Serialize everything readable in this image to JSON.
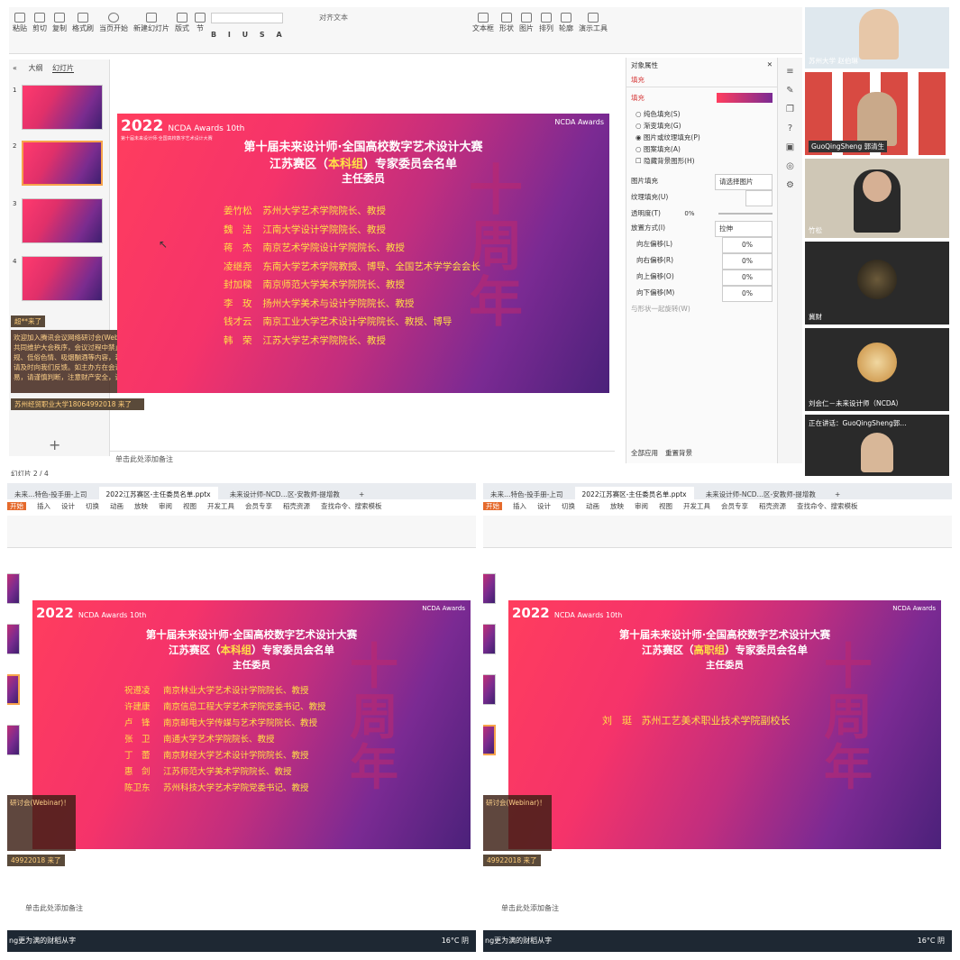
{
  "top": {
    "ribbon": {
      "row1": [
        "粘贴",
        "剪切",
        "复制",
        "格式刷",
        "当页开始",
        "新建幻灯片",
        "版式",
        "节",
        "文本框",
        "形状",
        "图片",
        "演示工具"
      ],
      "row2": [
        "对齐文本",
        "排列",
        "轮廓"
      ]
    },
    "outline_tabs": [
      "大纲",
      "幻灯片"
    ],
    "thumb_numbers": [
      "1",
      "2",
      "3",
      "4"
    ],
    "notes_placeholder": "单击此处添加备注",
    "status": "幻灯片 2 / 4",
    "properties": {
      "title": "对象属性",
      "tab": "填充",
      "section": "填充",
      "options": [
        "纯色填充(S)",
        "渐变填充(G)",
        "图片或纹理填充(P)",
        "图案填充(A)",
        "隐藏背景图形(H)"
      ],
      "picture_fill_label": "图片填充",
      "picture_fill_value": "请选择图片",
      "texture_label": "纹理填充(U)",
      "transparency_label": "透明度(T)",
      "transparency_value": "0%",
      "placement_label": "放置方式(I)",
      "placement_value": "拉伸",
      "offsets": [
        {
          "label": "向左偏移(L)",
          "value": "0%"
        },
        {
          "label": "向右偏移(R)",
          "value": "0%"
        },
        {
          "label": "向上偏移(O)",
          "value": "0%"
        },
        {
          "label": "向下偏移(M)",
          "value": "0%"
        }
      ],
      "rotate_label": "与形状一起旋转(W)",
      "apply_all": "全部应用",
      "reset": "重置背景"
    },
    "chat_note": "超**来了",
    "chat_text": "欢迎加入腾讯会议网络研讨会(Webinar)！请大家共同维护大会秩序，会议过程中禁止出现违法违规、低俗色情、吸烟酗酒等内容，若发现违规行为请及时向我们反馈。如主办方在会议过程中引导交易，请谨慎判断，注意财产安全，谨防诈骗！",
    "chat_join": "苏州经贸职业大学18064992018 来了"
  },
  "slides": {
    "logo_year": "2022",
    "logo_brand": "NCDA Awards 10th",
    "logo_sub": "第十届未来设计师·全国高校数字艺术设计大赛",
    "corner_logo": "NCDA Awards",
    "title1": "第十届未来设计师·全国高校数字艺术设计大赛",
    "title2_prefix": "江苏赛区（",
    "title2_group_main": "本科组",
    "title2_group_vocational": "高职组",
    "title2_suffix": "）专家委员会名单",
    "title3": "主任委员",
    "watermark": "十周年",
    "list_a": [
      {
        "name": "姜竹松",
        "desc": "苏州大学艺术学院院长、教授"
      },
      {
        "name": "魏　洁",
        "desc": "江南大学设计学院院长、教授"
      },
      {
        "name": "蒋　杰",
        "desc": "南京艺术学院设计学院院长、教授"
      },
      {
        "name": "凌继尧",
        "desc": "东南大学艺术学院教授、博导、全国艺术学学会会长"
      },
      {
        "name": "封加樑",
        "desc": "南京师范大学美术学院院长、教授"
      },
      {
        "name": "李　玫",
        "desc": "扬州大学美术与设计学院院长、教授"
      },
      {
        "name": "钱才云",
        "desc": "南京工业大学艺术设计学院院长、教授、博导"
      },
      {
        "name": "韩　荣",
        "desc": "江苏大学艺术学院院长、教授"
      }
    ],
    "list_b": [
      {
        "name": "祝遵凌",
        "desc": "南京林业大学艺术设计学院院长、教授"
      },
      {
        "name": "许建康",
        "desc": "南京信息工程大学艺术学院党委书记、教授"
      },
      {
        "name": "卢　锋",
        "desc": "南京邮电大学传媒与艺术学院院长、教授"
      },
      {
        "name": "张　卫",
        "desc": "南通大学艺术学院院长、教授"
      },
      {
        "name": "丁　蕾",
        "desc": "南京财经大学艺术设计学院院长、教授"
      },
      {
        "name": "惠　剑",
        "desc": "江苏师范大学美术学院院长、教授"
      },
      {
        "name": "陈卫东",
        "desc": "苏州科技大学艺术学院党委书记、教授"
      }
    ],
    "list_c": [
      {
        "name": "刘　珽",
        "desc": "苏州工艺美术职业技术学院副校长"
      }
    ]
  },
  "participants": [
    {
      "name": "苏州大学 赵伯琳"
    },
    {
      "name": "GuoQingSheng 郭清生"
    },
    {
      "name": "竹松"
    },
    {
      "name": "冀财"
    },
    {
      "name": "刘会仁－未来设计师（NCDA）"
    }
  ],
  "speaking": "正在讲话：GuoQingSheng郭…",
  "bottom": {
    "tabs_left": [
      "未来…特色-投手册-上司",
      "2022江苏赛区-主任委员名单.pptx",
      "未来设计师-NCD…区-安教师-提增教"
    ],
    "tabs_right": [
      "未来…特色-投手册-上司",
      "2022江苏赛区-主任委员名单.pptx",
      "未来设计师-NCD…区-安教师-提增教"
    ],
    "menu": [
      "开始",
      "插入",
      "设计",
      "切换",
      "动画",
      "放映",
      "审阅",
      "视图",
      "开发工具",
      "会员专享",
      "稻壳资源",
      "查找命令、搜索模板"
    ],
    "notes_placeholder": "单击此处添加备注",
    "weather": "16°C 阴",
    "ime": "ng更为满的财稻从字",
    "chat_title": "研讨会(Webinar)！",
    "chat_join": "49922018 来了"
  },
  "colors": {
    "accent": "#f7a34b",
    "highlight": "#ffe046",
    "slide_from": "#ff3d5e",
    "slide_to": "#4b217a"
  }
}
